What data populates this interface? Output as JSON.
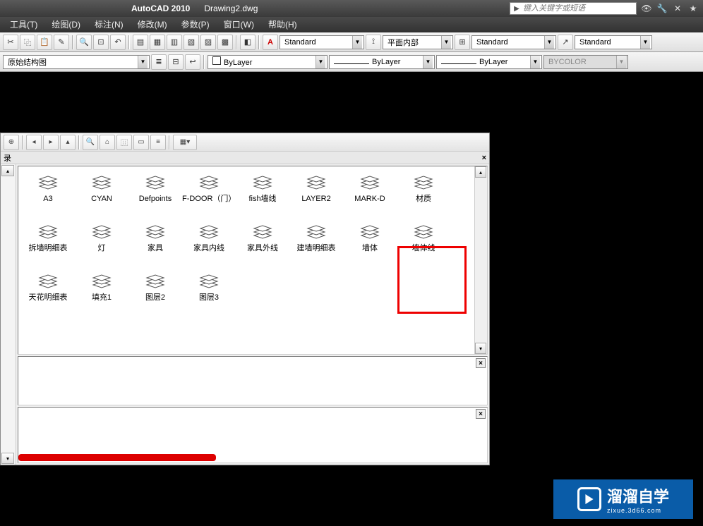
{
  "title": {
    "app": "AutoCAD 2010",
    "doc": "Drawing2.dwg"
  },
  "search": {
    "placeholder": "键入关键字或短语"
  },
  "menu": {
    "tools": "工具(T)",
    "draw": "绘图(D)",
    "dim": "标注(N)",
    "modify": "修改(M)",
    "param": "参数(P)",
    "window": "窗口(W)",
    "help": "帮助(H)"
  },
  "toolbar1": {
    "style1": "Standard",
    "style2": "平面内部",
    "style3": "Standard",
    "style4": "Standard"
  },
  "toolbar2": {
    "layer_combo": "原始结构图",
    "color_combo": "ByLayer",
    "line_combo": "ByLayer",
    "lw_combo": "ByLayer",
    "plot_combo": "BYCOLOR"
  },
  "panel": {
    "header": "录",
    "close": "×",
    "layers_row1": [
      "A3",
      "CYAN",
      "Defpoints",
      "F-DOOR（门）",
      "fish墙线",
      "LAYER2",
      "MARK-D",
      "材质"
    ],
    "layers_row2": [
      "拆墙明细表",
      "灯",
      "家具",
      "家具内线",
      "家具外线",
      "建墙明细表",
      "墙体",
      "墙体线"
    ],
    "layers_row3": [
      "天花明细表",
      "填充1",
      "图层2",
      "图层3"
    ]
  },
  "watermark": {
    "text": "溜溜自学",
    "sub": "zixue.3d66.com"
  }
}
